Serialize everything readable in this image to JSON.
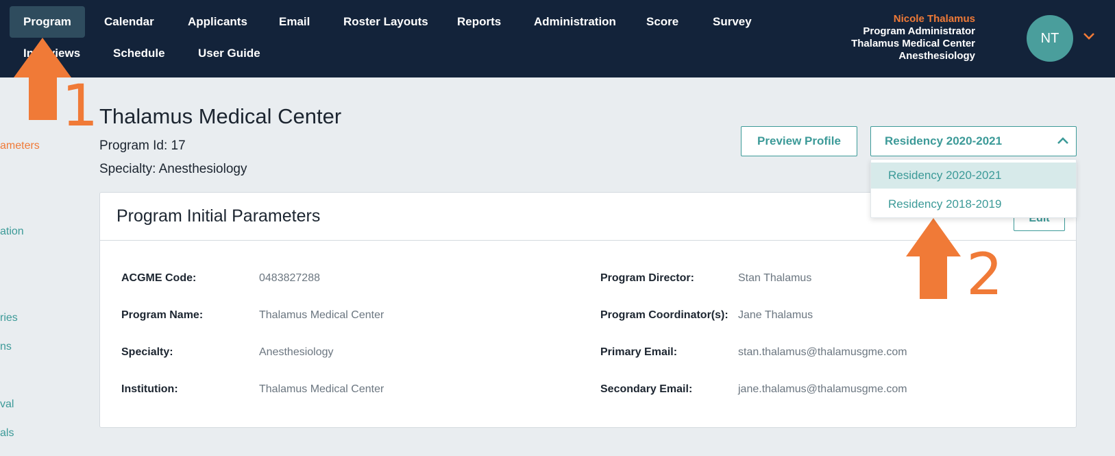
{
  "nav": {
    "row1": [
      "Program",
      "Calendar",
      "Applicants",
      "Email",
      "Roster Layouts",
      "Reports",
      "Administration",
      "Score",
      "Survey"
    ],
    "row2": [
      "Interviews",
      "Schedule",
      "User Guide"
    ],
    "active": "Program"
  },
  "user": {
    "name": "Nicole Thalamus",
    "role": "Program Administrator",
    "institution": "Thalamus Medical Center",
    "specialty": "Anesthesiology",
    "initials": "NT"
  },
  "sidebar": {
    "items": [
      "ameters",
      "ation",
      "ries",
      "ns",
      "val",
      "als"
    ]
  },
  "header": {
    "title": "Thalamus Medical Center",
    "program_id": "Program Id: 17",
    "specialty": "Specialty: Anesthesiology",
    "preview_label": "Preview Profile",
    "season_selected": "Residency 2020-2021",
    "season_options": [
      "Residency 2020-2021",
      "Residency 2018-2019"
    ]
  },
  "card": {
    "title": "Program Initial Parameters",
    "edit_label": "Edit",
    "left_fields": [
      {
        "label": "ACGME Code:",
        "value": "0483827288"
      },
      {
        "label": "Program Name:",
        "value": "Thalamus Medical Center"
      },
      {
        "label": "Specialty:",
        "value": "Anesthesiology"
      },
      {
        "label": "Institution:",
        "value": "Thalamus Medical Center"
      }
    ],
    "right_fields": [
      {
        "label": "Program Director:",
        "value": "Stan Thalamus"
      },
      {
        "label": "Program Coordinator(s):",
        "value": "Jane Thalamus"
      },
      {
        "label": "Primary Email:",
        "value": "stan.thalamus@thalamusgme.com"
      },
      {
        "label": "Secondary Email:",
        "value": "jane.thalamus@thalamusgme.com"
      }
    ]
  },
  "annotations": {
    "step1": "1",
    "step2": "2"
  },
  "colors": {
    "nav_bg": "#13233a",
    "accent": "#3c9a98",
    "highlight": "#f07a37",
    "avatar": "#4a9e9c"
  }
}
